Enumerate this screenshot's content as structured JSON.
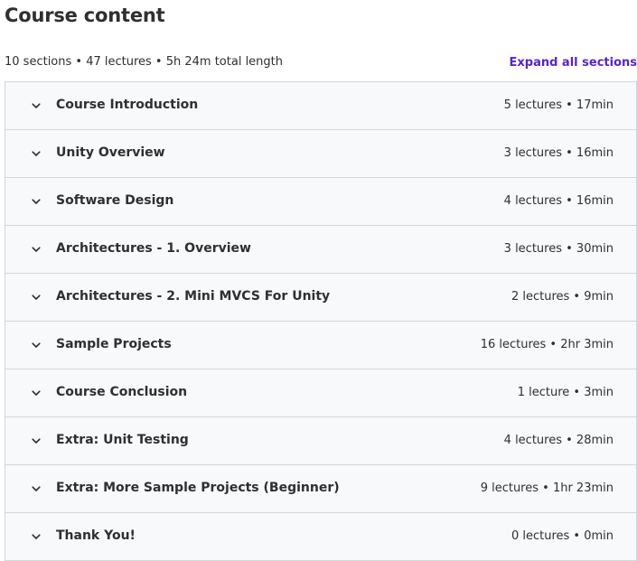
{
  "header": {
    "title": "Course content"
  },
  "summary": {
    "text": "10 sections • 47 lectures • 5h 24m total length",
    "expand_label": "Expand all sections"
  },
  "colors": {
    "accent": "#5624d0",
    "row_background": "#f7f9fa",
    "border": "#d1d7dc",
    "text": "#2d2f31"
  },
  "sections": [
    {
      "title": "Course Introduction",
      "meta": "5 lectures • 17min",
      "icon": "chevron-down-icon"
    },
    {
      "title": "Unity Overview",
      "meta": "3 lectures • 16min",
      "icon": "chevron-down-icon"
    },
    {
      "title": "Software Design",
      "meta": "4 lectures • 16min",
      "icon": "chevron-down-icon"
    },
    {
      "title": "Architectures - 1. Overview",
      "meta": "3 lectures • 30min",
      "icon": "chevron-down-icon"
    },
    {
      "title": "Architectures - 2. Mini MVCS For Unity",
      "meta": "2 lectures • 9min",
      "icon": "chevron-down-icon"
    },
    {
      "title": "Sample Projects",
      "meta": "16 lectures • 2hr 3min",
      "icon": "chevron-down-icon"
    },
    {
      "title": "Course Conclusion",
      "meta": "1 lecture • 3min",
      "icon": "chevron-down-icon"
    },
    {
      "title": "Extra: Unit Testing",
      "meta": "4 lectures • 28min",
      "icon": "chevron-down-icon"
    },
    {
      "title": "Extra: More Sample Projects (Beginner)",
      "meta": "9 lectures • 1hr 23min",
      "icon": "chevron-down-icon"
    },
    {
      "title": "Thank You!",
      "meta": "0 lectures • 0min",
      "icon": "chevron-down-icon"
    }
  ]
}
